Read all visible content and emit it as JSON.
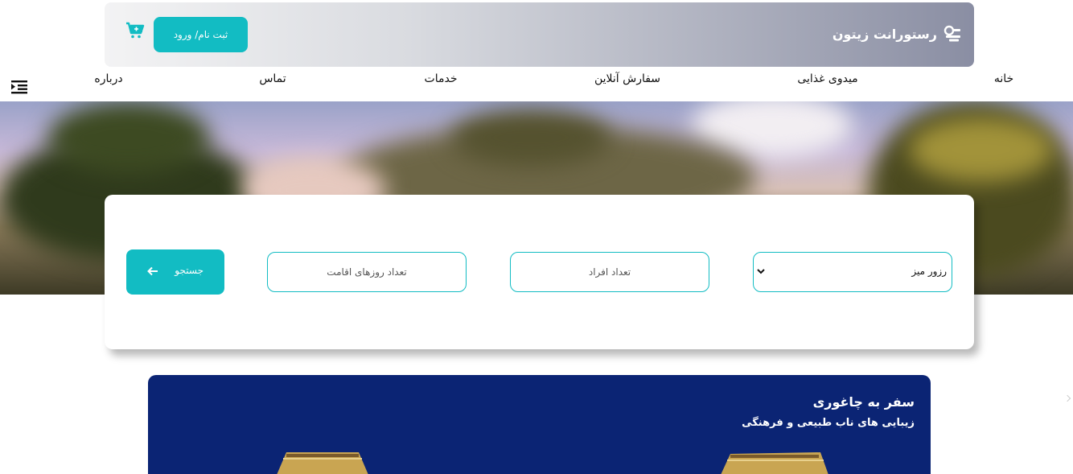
{
  "header": {
    "brand_name": "رستورانت زیتون",
    "login_label": "ثبت نام/ ورود",
    "brand_icon": "restaurant-logo-icon",
    "cart_icon": "cart-add-icon"
  },
  "nav": {
    "items": [
      "خانه",
      "میدوی غذایی",
      "سفارش آنلاین",
      "خدمات",
      "تماس",
      "درباره"
    ],
    "menu_icon": "menu-collapse-icon"
  },
  "booking": {
    "select_value": "رزور میز",
    "people_placeholder": "تعداد افراد",
    "days_placeholder": "تعداد روزهای اقامت",
    "search_label": "جستجو",
    "search_icon": "arrow-left-icon"
  },
  "promo": {
    "title": "سفر به چاغوری",
    "subtitle": "زیبایی های ناب طبیعی و فرهنگی"
  },
  "colors": {
    "accent": "#12bcc3",
    "promo_bg": "#0b2474",
    "header_gradient_end": "#8a8ea3"
  }
}
